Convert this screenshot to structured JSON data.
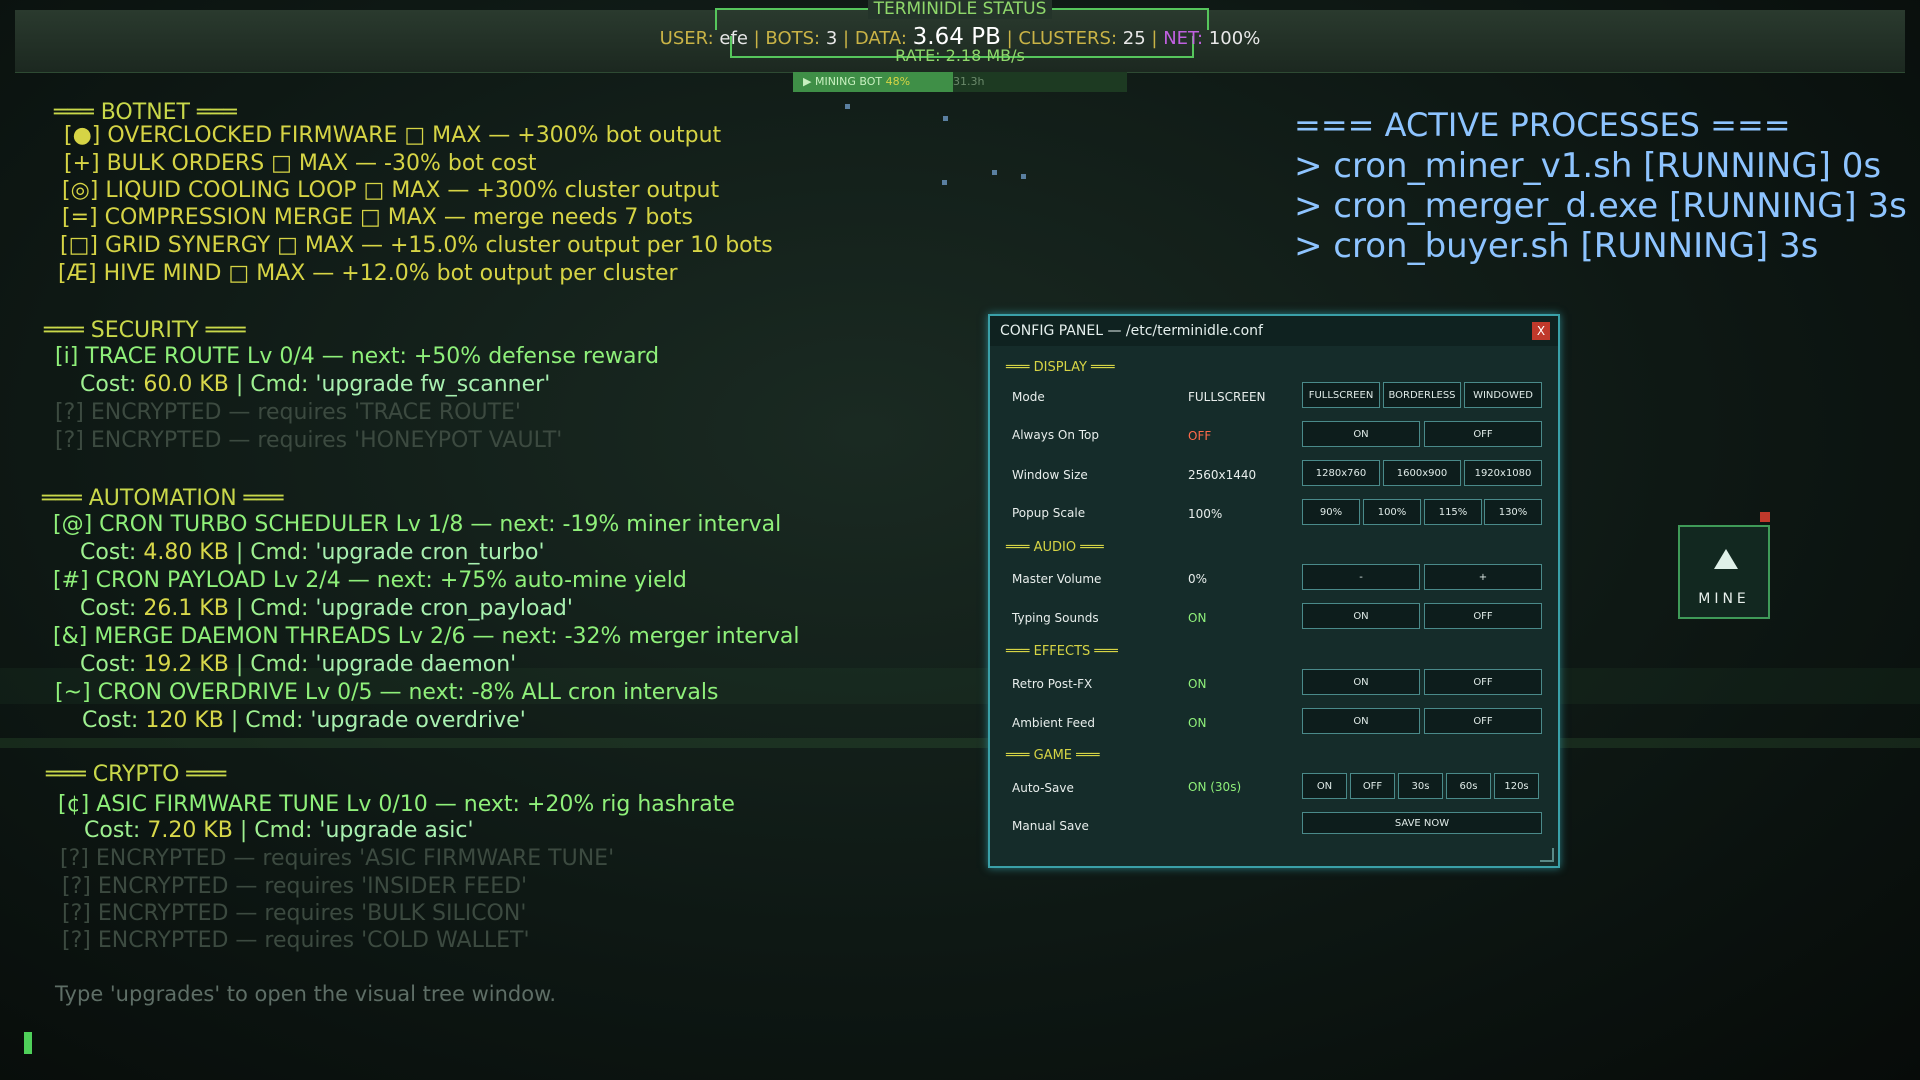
{
  "status": {
    "title": "TERMINIDLE STATUS",
    "user_label": "USER:",
    "user": "efe",
    "bots_label": "BOTS:",
    "bots": "3",
    "data_label": "DATA:",
    "data": "3.64 PB",
    "clusters_label": "CLUSTERS:",
    "clusters": "25",
    "net_label": "NET:",
    "net": "100%",
    "rate": "RATE: 2.18 MB/s"
  },
  "mining_bot": {
    "label": "▶ MINING BOT",
    "percent_text": "48%",
    "percent": 48,
    "time": "31.3h"
  },
  "botnet": {
    "header": "═══ BOTNET ═══",
    "lines": [
      "[●] OVERCLOCKED FIRMWARE □ MAX — +300% bot output",
      "[+] BULK ORDERS □ MAX — -30% bot cost",
      "[◎] LIQUID COOLING LOOP □ MAX — +300% cluster output",
      "[=] COMPRESSION MERGE □ MAX — merge needs 7 bots",
      "[□] GRID SYNERGY □ MAX — +15.0% cluster output per 10 bots",
      "[Æ] HIVE MIND □ MAX — +12.0% bot output per cluster"
    ]
  },
  "security": {
    "header": "═══ SECURITY ═══",
    "line1": "[i] TRACE ROUTE Lv 0/4 — next: +50% defense reward",
    "cost1_prefix": "Cost:",
    "cost1": "60.0 KB",
    "cost1_cmd_prefix": "| Cmd:",
    "cost1_cmd": "'upgrade fw_scanner'",
    "enc1": "[?] ENCRYPTED — requires 'TRACE ROUTE'",
    "enc2": "[?] ENCRYPTED — requires 'HONEYPOT VAULT'"
  },
  "automation": {
    "header": "═══ AUTOMATION ═══",
    "items": [
      {
        "line": "[@] CRON TURBO SCHEDULER Lv 1/8 — next: -19% miner interval",
        "cost": "4.80 KB",
        "cmd": "'upgrade cron_turbo'"
      },
      {
        "line": "[#] CRON PAYLOAD Lv 2/4 — next: +75% auto-mine yield",
        "cost": "26.1 KB",
        "cmd": "'upgrade cron_payload'"
      },
      {
        "line": "[&] MERGE DAEMON THREADS Lv 2/6 — next: -32% merger interval",
        "cost": "19.2 KB",
        "cmd": "'upgrade daemon'"
      },
      {
        "line": "[~] CRON OVERDRIVE Lv 0/5 — next: -8% ALL cron intervals",
        "cost": "120 KB",
        "cmd": "'upgrade overdrive'"
      }
    ],
    "cost_prefix": "Cost:",
    "cmd_prefix": "| Cmd:"
  },
  "crypto": {
    "header": "═══ CRYPTO ═══",
    "line1": "[¢] ASIC FIRMWARE TUNE Lv 0/10 — next: +20% rig hashrate",
    "cost": "7.20 KB",
    "cmd": "'upgrade asic'",
    "enc": [
      "[?] ENCRYPTED — requires 'ASIC FIRMWARE TUNE'",
      "[?] ENCRYPTED — requires 'INSIDER FEED'",
      "[?] ENCRYPTED — requires 'BULK SILICON'",
      "[?] ENCRYPTED — requires 'COLD WALLET'"
    ]
  },
  "hint": "Type 'upgrades' to open the visual tree window.",
  "processes": {
    "header": "=== ACTIVE PROCESSES ===",
    "items": [
      "> cron_miner_v1.sh [RUNNING] 0s",
      "> cron_merger_d.exe [RUNNING] 3s",
      "> cron_buyer.sh [RUNNING] 3s"
    ]
  },
  "config": {
    "title": "CONFIG PANEL — /etc/terminidle.conf",
    "close": "X",
    "display": "═══ DISPLAY ═══",
    "mode_label": "Mode",
    "mode_value": "FULLSCREEN",
    "mode_opts": [
      "FULLSCREEN",
      "BORDERLESS",
      "WINDOWED"
    ],
    "aot_label": "Always On Top",
    "aot_value": "OFF",
    "ws_label": "Window Size",
    "ws_value": "2560x1440",
    "ws_opts": [
      "1280x760",
      "1600x900",
      "1920x1080"
    ],
    "ps_label": "Popup Scale",
    "ps_value": "100%",
    "ps_opts": [
      "90%",
      "100%",
      "115%",
      "130%"
    ],
    "audio": "═══ AUDIO ═══",
    "mv_label": "Master Volume",
    "mv_value": "0%",
    "mv_minus": "-",
    "mv_plus": "+",
    "ts_label": "Typing Sounds",
    "ts_value": "ON",
    "effects": "═══ EFFECTS ═══",
    "rp_label": "Retro Post-FX",
    "rp_value": "ON",
    "af_label": "Ambient Feed",
    "af_value": "ON",
    "game": "═══ GAME ═══",
    "as_label": "Auto-Save",
    "as_value": "ON (30s)",
    "as_opts": [
      "ON",
      "OFF",
      "30s",
      "60s",
      "120s"
    ],
    "ms_label": "Manual Save",
    "ms_button": "SAVE NOW",
    "on": "ON",
    "off": "OFF"
  },
  "mine_button": {
    "label": "MINE"
  }
}
